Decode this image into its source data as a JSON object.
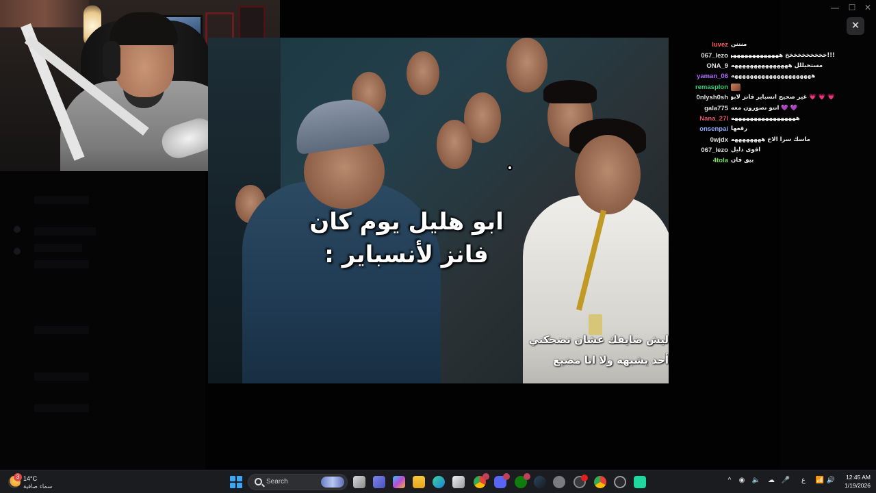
{
  "stream": {
    "caption_main": "ابو هليل يوم كان فانز لأنسباير :",
    "subtitle_line1": "ليش ضايفك عشان تضحكني",
    "subtitle_line2": "أحد يشبهه ولا انا مضيع"
  },
  "chat": {
    "messages": [
      {
        "user": "luvez",
        "color": "#ff5a5a",
        "text": "منننن",
        "emote": false
      },
      {
        "user": "067_lezo",
        "color": "#e0e0e0",
        "text": "!!!خخخخخخخخخخ هههههههههههههههه",
        "emote": false
      },
      {
        "user": "ONA_9",
        "color": "#e0e0e0",
        "text": "مستحيللل هههههههههههههههه",
        "emote": false
      },
      {
        "user": "yaman_06",
        "color": "#b06cff",
        "text": "هههههههههههههههههههههه",
        "emote": false
      },
      {
        "user": "remasplon",
        "color": "#35d07a",
        "text": "",
        "emote": true
      },
      {
        "user": "0nlysh0sh",
        "color": "#e0e0e0",
        "text": "💗 💗 💗 غير صحيح انسباير فانز لابوهليل 💗",
        "emote": false
      },
      {
        "user": "gala775",
        "color": "#e0e0e0",
        "text": "💜 💜 انتو تصورون معه",
        "emote": false
      },
      {
        "user": "Nana_27I",
        "color": "#e0506a",
        "text": "هههههههههههههههههه",
        "emote": false
      },
      {
        "user": "onsenpai",
        "color": "#8aa8ff",
        "text": "رقعها",
        "emote": false
      },
      {
        "user": "0wjdx",
        "color": "#e0e0e0",
        "text": "ماسك سرا الاخ ههههههههه",
        "emote": false
      },
      {
        "user": "067_lezo",
        "color": "#e0e0e0",
        "text": "اقوى دليل",
        "emote": false
      },
      {
        "user": "4tola",
        "color": "#7ae05a",
        "text": "بيق فان",
        "emote": false
      }
    ]
  },
  "taskbar": {
    "weather_temp": "14°C",
    "weather_desc": "سماء صافية",
    "weather_badge": "3",
    "search_placeholder": "Search",
    "clock_time": "12:45 AM",
    "clock_date": "1/19/2026",
    "lang": "ع"
  },
  "window": {
    "close_glyph": "✕",
    "ctrl_min": "—",
    "ctrl_max": "☐",
    "ctrl_close": "✕"
  }
}
